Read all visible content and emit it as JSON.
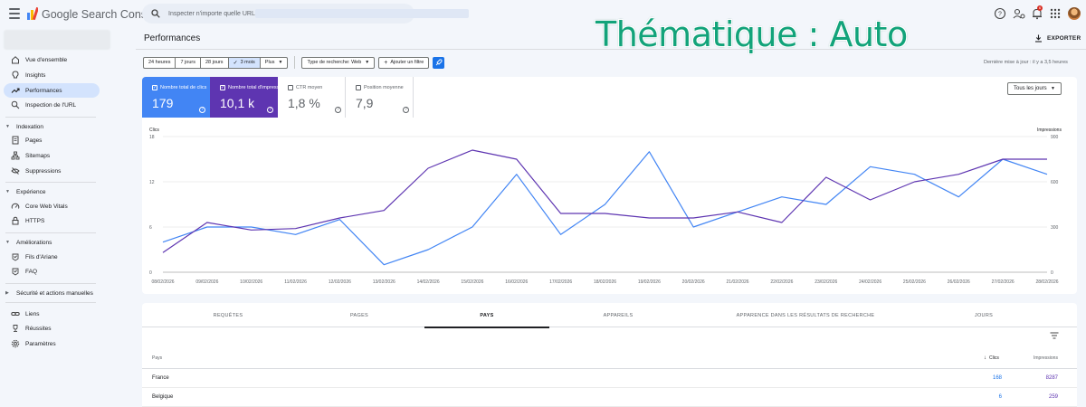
{
  "app": {
    "product_name": "Google Search Console"
  },
  "search": {
    "placeholder": "Inspecter n'importe quelle URL de"
  },
  "header": {
    "notification_count": "6"
  },
  "overlay": {
    "title": "Thématique : Auto"
  },
  "sidebar": {
    "items": [
      {
        "label": "Vue d'ensemble",
        "icon": "home-icon"
      },
      {
        "label": "Insights",
        "icon": "insights-icon"
      },
      {
        "label": "Performances",
        "icon": "trending-up-icon",
        "active": true
      },
      {
        "label": "Inspection de l'URL",
        "icon": "search-icon"
      }
    ],
    "sections": [
      {
        "label": "Indexation",
        "items": [
          {
            "label": "Pages",
            "icon": "pages-icon"
          },
          {
            "label": "Sitemaps",
            "icon": "sitemap-icon"
          },
          {
            "label": "Suppressions",
            "icon": "removal-icon"
          }
        ]
      },
      {
        "label": "Expérience",
        "items": [
          {
            "label": "Core Web Vitals",
            "icon": "speed-icon"
          },
          {
            "label": "HTTPS",
            "icon": "lock-icon"
          }
        ]
      },
      {
        "label": "Améliorations",
        "items": [
          {
            "label": "Fils d'Ariane",
            "icon": "breadcrumb-icon"
          },
          {
            "label": "FAQ",
            "icon": "faq-icon"
          }
        ]
      },
      {
        "label": "Sécurité et actions manuelles",
        "items": []
      }
    ],
    "footer_items": [
      {
        "label": "Liens",
        "icon": "link-icon"
      },
      {
        "label": "Réussites",
        "icon": "trophy-icon"
      },
      {
        "label": "Paramètres",
        "icon": "gear-icon"
      }
    ]
  },
  "main": {
    "title": "Performances",
    "export_label": "EXPORTER",
    "last_update": "Dernière mise à jour : il y a 3,5 heures",
    "date_filters": [
      "24 heures",
      "7 jours",
      "28 jours",
      "3 mois",
      "Plus"
    ],
    "selected_date_filter": "3 mois",
    "search_type_filter": "Type de recherche: Web",
    "add_filter_label": "Ajouter un filtre"
  },
  "metrics": [
    {
      "label": "Nombre total de clics",
      "value": "179",
      "selected": true
    },
    {
      "label": "Nombre total d'impressions",
      "value": "10,1 k",
      "selected": true
    },
    {
      "label": "CTR moyen",
      "value": "1,8 %",
      "selected": false
    },
    {
      "label": "Position moyenne",
      "value": "7,9",
      "selected": false
    }
  ],
  "chart_controls": {
    "range_label": "Tous les jours"
  },
  "colors": {
    "clicks": "#4285f4",
    "impressions": "#5e35b1",
    "accent": "#1a73e8",
    "overlay_text": "#12a37a"
  },
  "chart_data": {
    "type": "line",
    "ylabel_left": "Clics",
    "ylabel_right": "Impressions",
    "y_ticks_left": [
      "18",
      "12",
      "6",
      "0"
    ],
    "y_ticks_right": [
      "900",
      "600",
      "300",
      "0"
    ],
    "ylim_left": [
      0,
      18
    ],
    "ylim_right": [
      0,
      900
    ],
    "grid": true,
    "x": [
      "08/02/2026",
      "09/02/2026",
      "10/02/2026",
      "11/02/2026",
      "12/02/2026",
      "13/02/2026",
      "14/02/2026",
      "15/02/2026",
      "16/02/2026",
      "17/02/2026",
      "18/02/2026",
      "19/02/2026",
      "20/02/2026",
      "21/02/2026",
      "22/02/2026",
      "23/02/2026",
      "24/02/2026",
      "25/02/2026",
      "26/02/2026",
      "27/02/2026",
      "28/02/2026"
    ],
    "series": [
      {
        "name": "Clics",
        "axis": "left",
        "values": [
          4,
          6,
          6,
          5,
          7,
          1,
          3,
          6,
          13,
          5,
          9,
          16,
          6,
          8,
          10,
          9,
          14,
          13,
          10,
          15,
          13
        ]
      },
      {
        "name": "Impressions",
        "axis": "right",
        "values": [
          130,
          330,
          280,
          290,
          360,
          410,
          690,
          810,
          750,
          390,
          390,
          360,
          360,
          400,
          330,
          630,
          480,
          600,
          650,
          750,
          750
        ]
      }
    ]
  },
  "table": {
    "tabs": [
      "REQUÊTES",
      "PAGES",
      "PAYS",
      "APPAREILS",
      "APPARENCE DANS LES RÉSULTATS DE RECHERCHE",
      "JOURS"
    ],
    "active_tab": "PAYS",
    "columns": [
      "Pays",
      "Clics",
      "Impressions"
    ],
    "rows": [
      {
        "country": "France",
        "clicks": "168",
        "impressions": "8287"
      },
      {
        "country": "Belgique",
        "clicks": "6",
        "impressions": "259"
      }
    ]
  }
}
